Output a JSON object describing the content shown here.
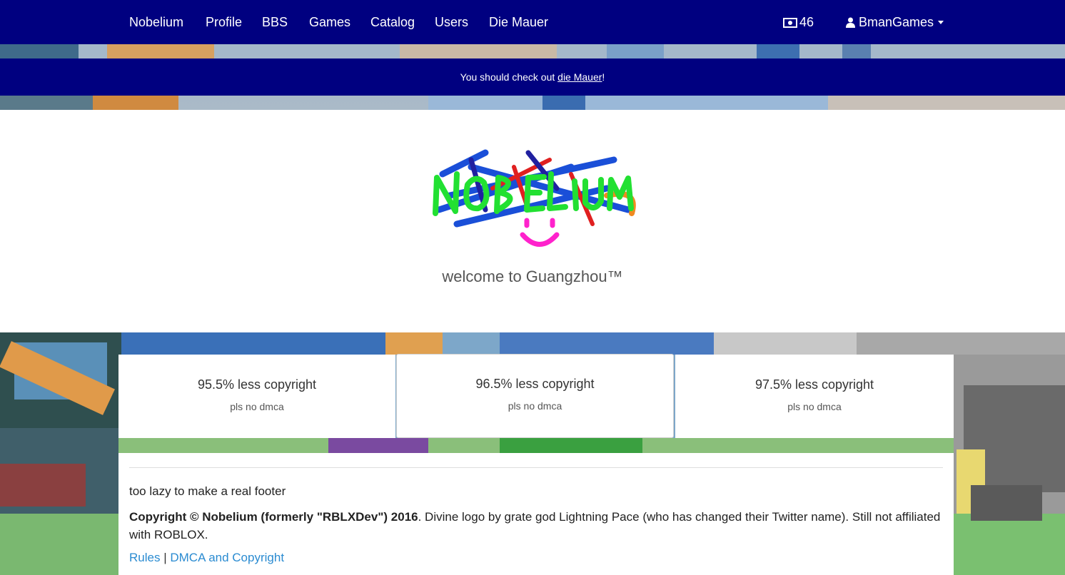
{
  "colors": {
    "nav": "#000080",
    "link": "#2a8bd1"
  },
  "nav": {
    "brand": "Nobelium",
    "links": [
      "Profile",
      "BBS",
      "Games",
      "Catalog",
      "Users",
      "Die Mauer"
    ],
    "cash_icon": "money-icon",
    "cash": "46",
    "user_icon": "user-icon",
    "username": "BmanGames"
  },
  "notice": {
    "prefix": "You should check out ",
    "link": "die Mauer",
    "suffix": "!"
  },
  "jumbotron": {
    "logo_text": "NOBELIUM",
    "welcome": "welcome to Guangzhou™"
  },
  "features": [
    {
      "title": "95.5% less copyright",
      "sub": "pls no dmca"
    },
    {
      "title": "96.5% less copyright",
      "sub": "pls no dmca"
    },
    {
      "title": "97.5% less copyright",
      "sub": "pls no dmca"
    }
  ],
  "footer": {
    "lazy": "too lazy to make a real footer",
    "copyright_bold": "Copyright © Nobelium (formerly \"RBLXDev\") 2016",
    "copyright_rest": ". Divine logo by grate god Lightning Pace (who has changed their Twitter name). Still not affiliated with ROBLOX.",
    "rules": "Rules",
    "sep": "|",
    "dmca": "DMCA and Copyright"
  }
}
